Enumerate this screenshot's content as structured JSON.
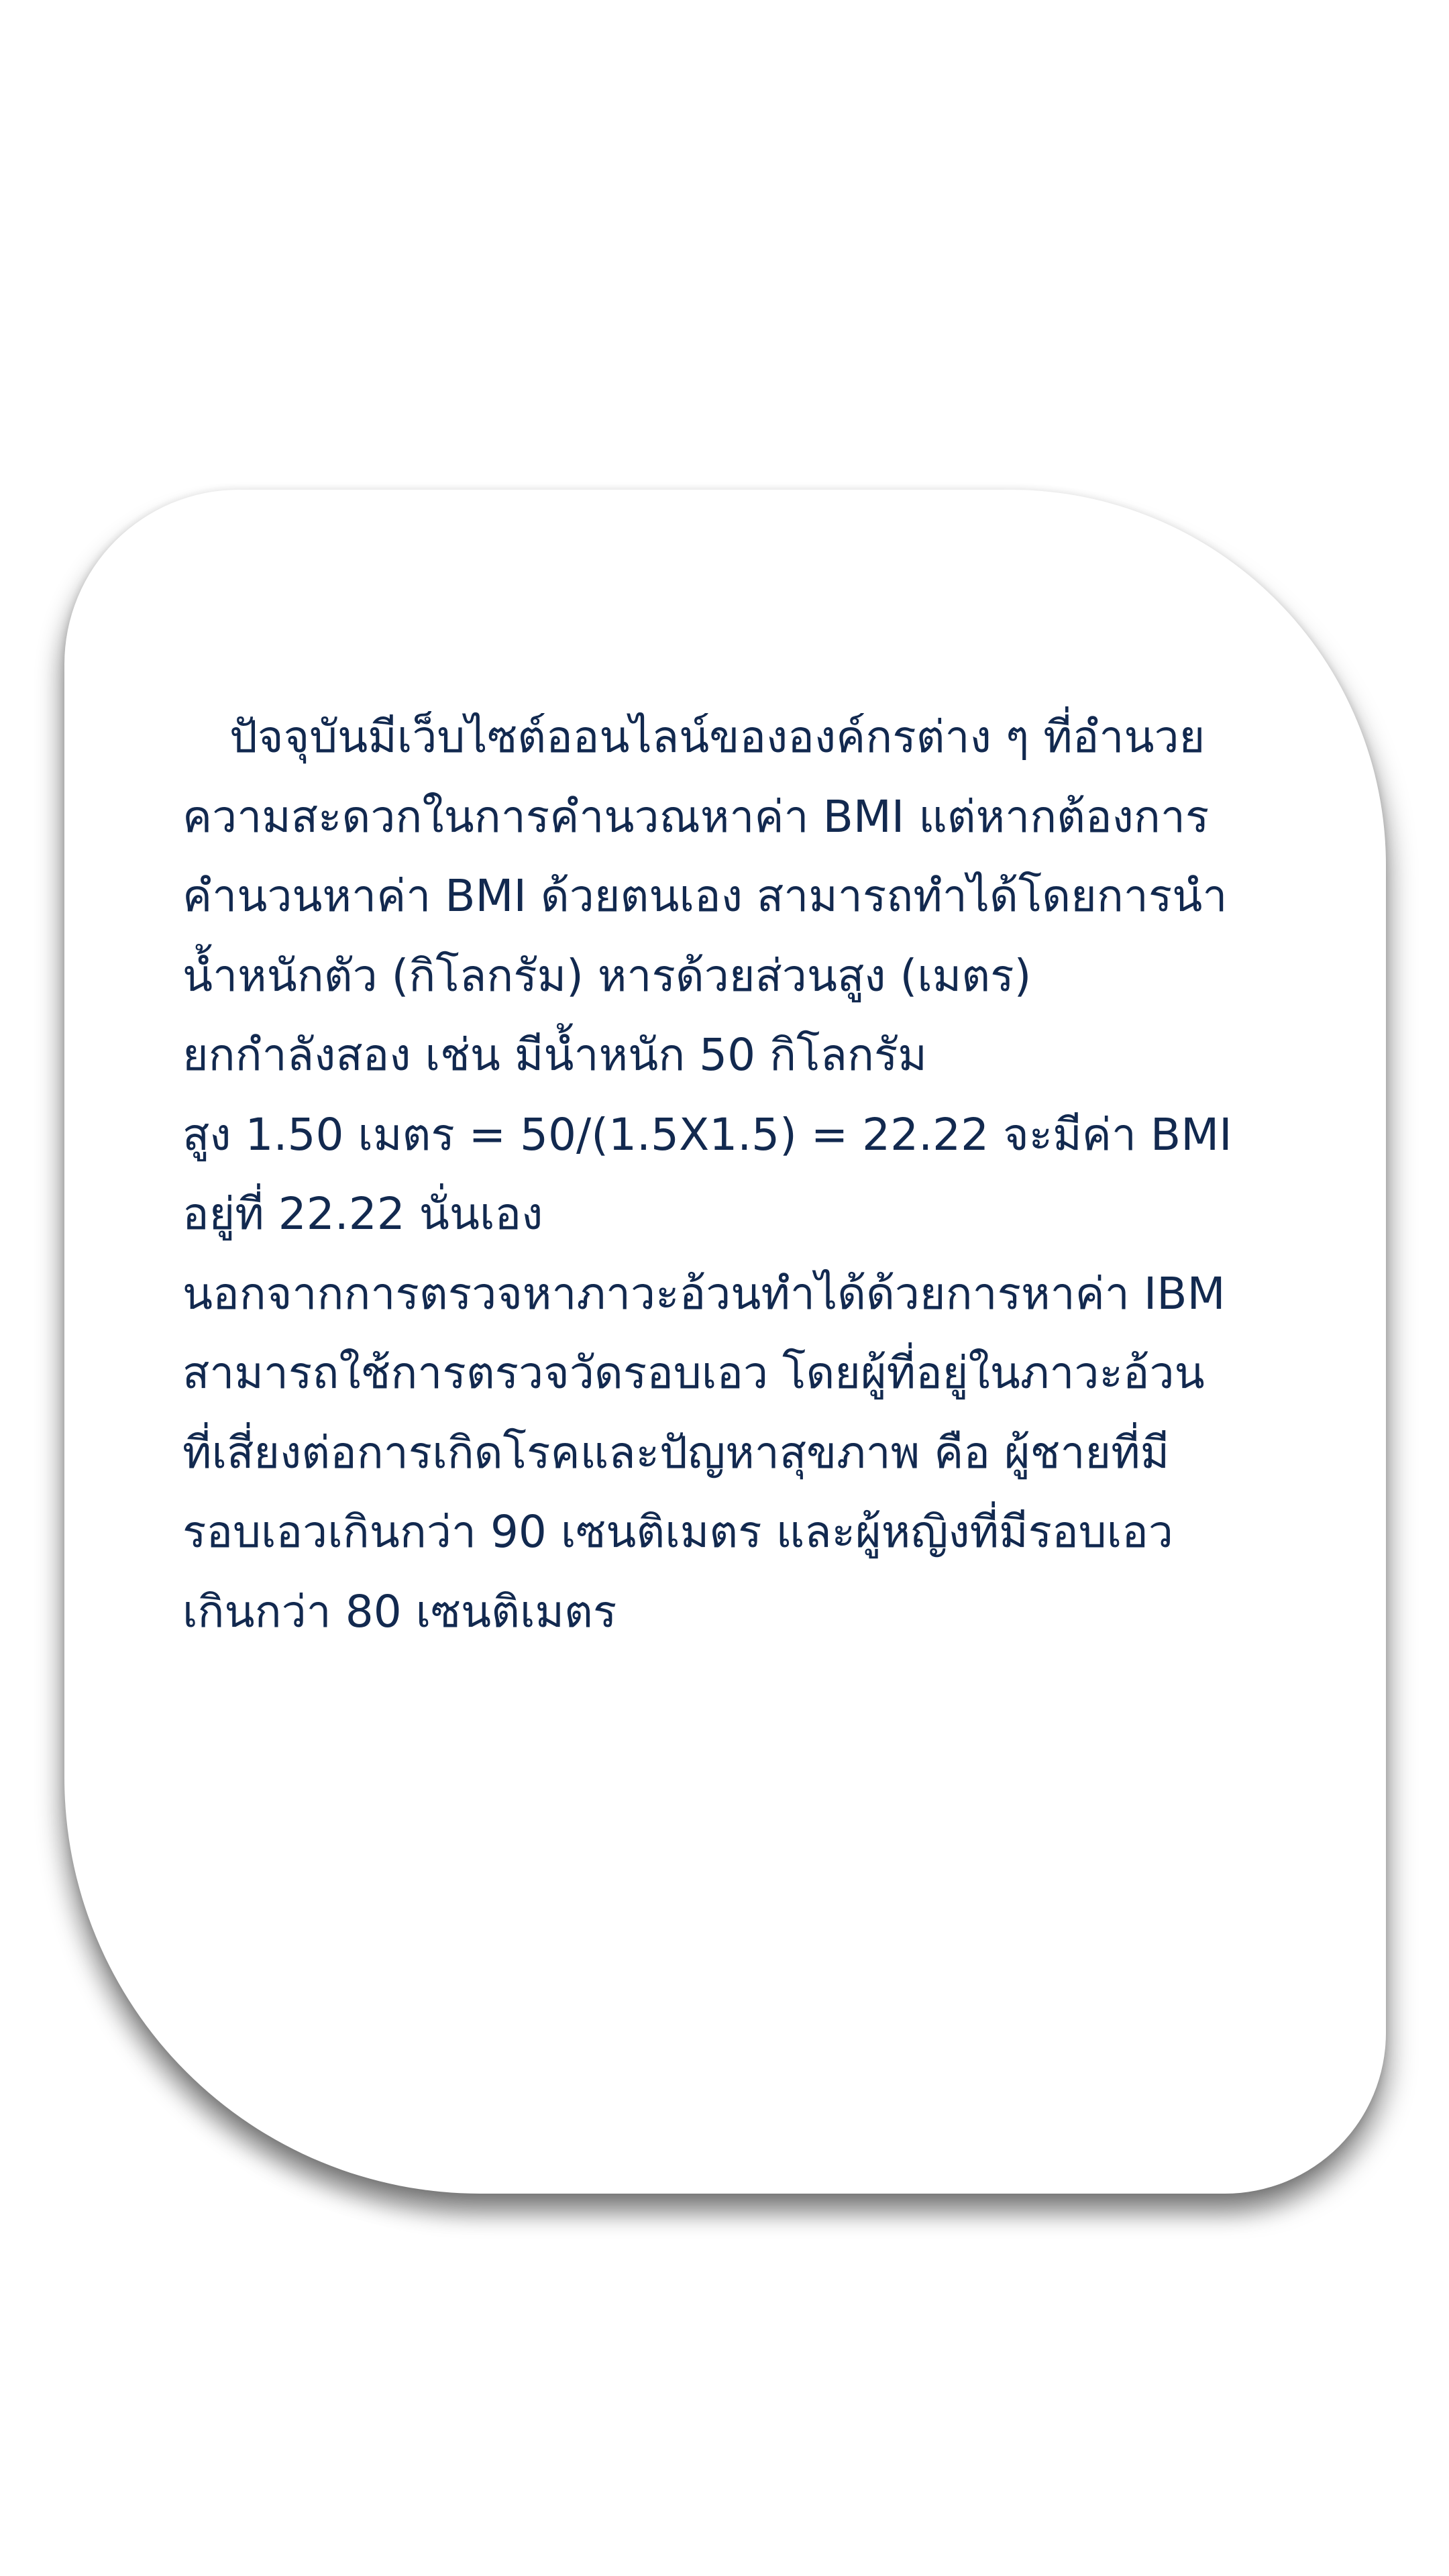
{
  "card": {
    "lines": [
      "ปัจจุบันมีเว็บไซต์ออนไลน์ขององค์กรต่าง ๆ ที่อำนวย",
      "ความสะดวกในการคำนวณหาค่า BMI แต่หากต้องการ",
      "คำนวนหาค่า BMI ด้วยตนเอง สามารถทำได้โดยการนำ",
      "น้ำหนักตัว (กิโลกรัม) หารด้วยส่วนสูง (เมตร)",
      "ยกกำลังสอง เช่น มีน้ำหนัก 50 กิโลกรัม",
      "สูง 1.50 เมตร = 50/(1.5X1.5) = 22.22 จะมีค่า BMI",
      "อยู่ที่ 22.22 นั่นเอง",
      "นอกจากการตรวจหาภาวะอ้วนทำได้ด้วยการหาค่า IBM",
      "สามารถใช้การตรวจวัดรอบเอว โดยผู้ที่อยู่ในภาวะอ้วน",
      "ที่เสี่ยงต่อการเกิดโรคและปัญหาสุขภาพ คือ ผู้ชายที่มี",
      "รอบเอวเกินกว่า 90 เซนติเมตร และผู้หญิงที่มีรอบเอว",
      "เกินกว่า 80 เซนติเมตร"
    ]
  }
}
